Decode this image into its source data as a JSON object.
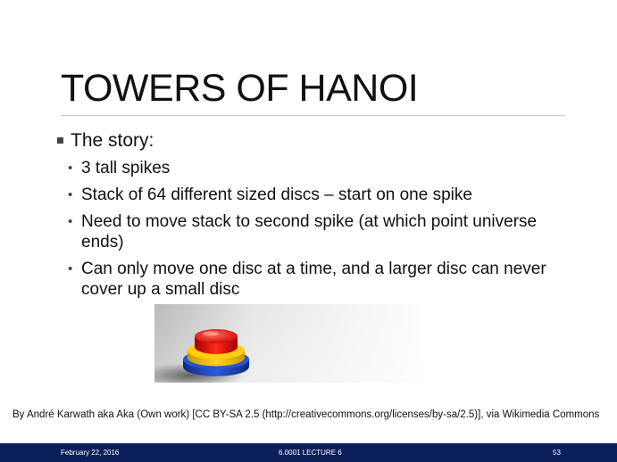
{
  "slide": {
    "title": "TOWERS OF HANOI",
    "heading": "The story:",
    "bullets": [
      "3 tall spikes",
      "Stack of 64 different sized discs – start on one spike",
      "Need to move stack to second spike (at which point universe ends)",
      "Can only move one disc at a time, and a larger disc can never cover up a small disc"
    ],
    "image_credit": "By André Karwath aka Aka (Own work) [CC BY-SA 2.5 (http://creativecommons.org/licenses/by-sa/2.5)], via Wikimedia Commons"
  },
  "footer": {
    "date": "February 22, 2016",
    "course": "6.0001 LECTURE 6",
    "page": "53"
  },
  "colors": {
    "footer_bg": "#0b1f5a",
    "disc_red": "#e01010",
    "disc_yellow": "#f2c200",
    "disc_blue": "#1a3fb0"
  },
  "image": {
    "subject": "stacked-discs-photo"
  }
}
